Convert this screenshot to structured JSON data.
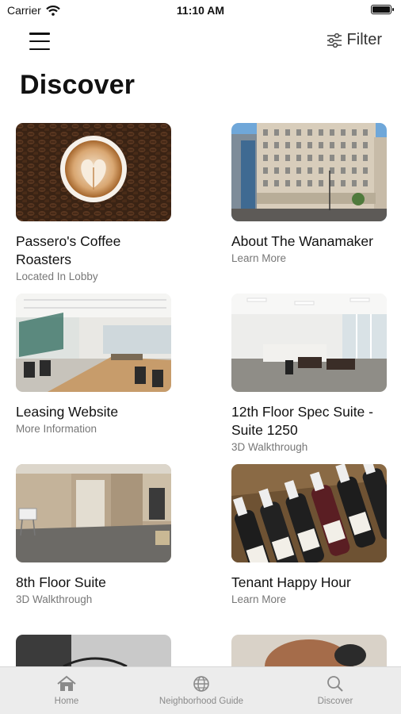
{
  "status_bar": {
    "carrier": "Carrier",
    "time": "11:10 AM"
  },
  "header": {
    "menu_icon": "hamburger-icon",
    "filter_label": "Filter",
    "filter_icon": "sliders-icon"
  },
  "page": {
    "title": "Discover"
  },
  "cards": [
    {
      "title": "Passero's Coffee Roasters",
      "subtitle": "Located In Lobby",
      "image": "latte-art-coffee-beans"
    },
    {
      "title": "About The Wanamaker",
      "subtitle": "Learn More",
      "image": "wanamaker-building-exterior"
    },
    {
      "title": "Leasing Website",
      "subtitle": "More Information",
      "image": "open-office-interior"
    },
    {
      "title": "12th Floor Spec Suite - Suite 1250",
      "subtitle": "3D Walkthrough",
      "image": "white-office-suite"
    },
    {
      "title": "8th Floor Suite",
      "subtitle": "3D Walkthrough",
      "image": "office-hallway-carpet"
    },
    {
      "title": "Tenant Happy Hour",
      "subtitle": "Learn More",
      "image": "wine-bottles-crate"
    },
    {
      "title": "",
      "subtitle": "",
      "image": "partial-card-dark"
    },
    {
      "title": "",
      "subtitle": "",
      "image": "partial-card-person"
    }
  ],
  "tab_bar": {
    "tabs": [
      {
        "label": "Home",
        "icon": "home-icon"
      },
      {
        "label": "Neighborhood Guide",
        "icon": "globe-icon"
      },
      {
        "label": "Discover",
        "icon": "search-icon"
      }
    ]
  }
}
